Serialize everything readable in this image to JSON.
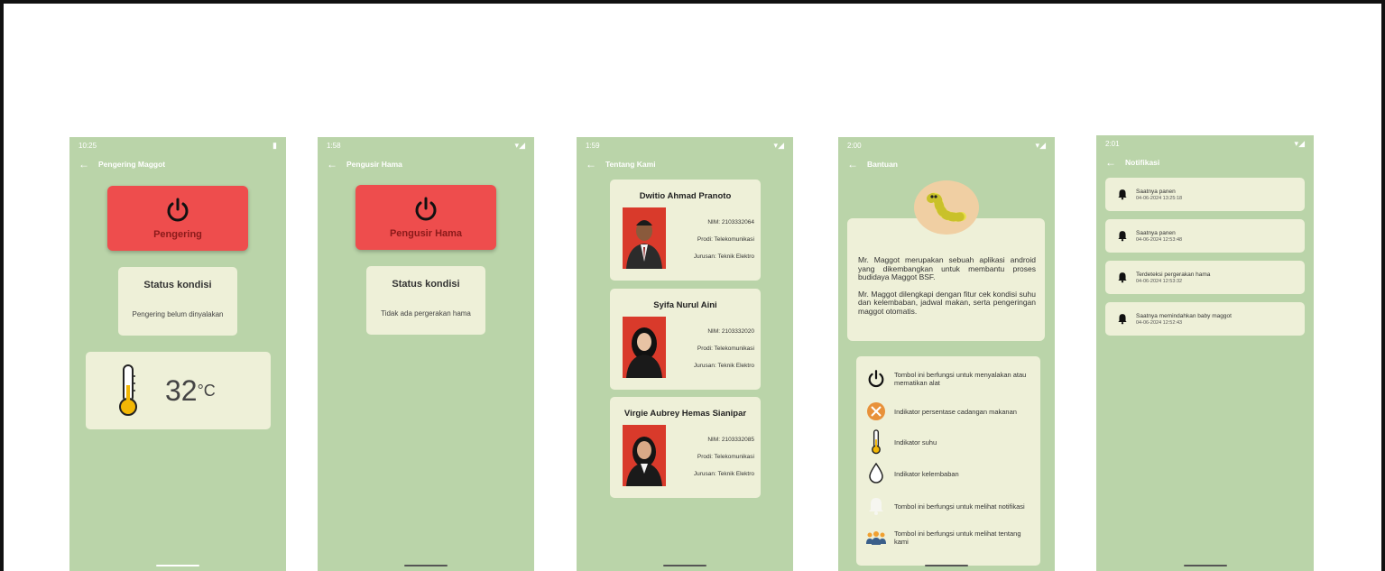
{
  "screens": [
    {
      "status_time": "10:25",
      "title": "Pengering Maggot",
      "power_label": "Pengering",
      "status_title": "Status kondisi",
      "status_text": "Pengering belum dinyalakan",
      "temperature_value": "32",
      "temperature_unit": "°C"
    },
    {
      "status_time": "1:58",
      "title": "Pengusir Hama",
      "power_label": "Pengusir Hama",
      "status_title": "Status kondisi",
      "status_text": "Tidak ada pergerakan hama"
    },
    {
      "status_time": "1:59",
      "title": "Tentang Kami",
      "members": [
        {
          "name": "Dwitio Ahmad Pranoto",
          "nim": "NIM: 2103332064",
          "prodi": "Prodi: Telekomunikasi",
          "jurusan": "Jurusan: Teknik Elektro"
        },
        {
          "name": "Syifa Nurul Aini",
          "nim": "NIM: 2103332020",
          "prodi": "Prodi: Telekomunikasi",
          "jurusan": "Jurusan: Teknik Elektro"
        },
        {
          "name": "Virgie Aubrey Hemas Sianipar",
          "nim": "NIM: 2103332085",
          "prodi": "Prodi: Telekomunikasi",
          "jurusan": "Jurusan: Teknik Elektro"
        }
      ]
    },
    {
      "status_time": "2:00",
      "title": "Bantuan",
      "about_p1": "Mr. Maggot merupakan sebuah aplikasi android yang dikembangkan untuk membantu proses budidaya Maggot BSF.",
      "about_p2": "Mr. Maggot dilengkapi dengan fitur cek kondisi suhu dan kelembaban, jadwal makan, serta pengeringan maggot otomatis.",
      "legend": [
        {
          "icon": "power-icon",
          "text": "Tombol ini berfungsi untuk menyalakan atau mematikan alat"
        },
        {
          "icon": "food-icon",
          "text": "Indikator persentase cadangan makanan"
        },
        {
          "icon": "thermometer-icon",
          "text": "Indikator suhu"
        },
        {
          "icon": "droplet-icon",
          "text": "Indikator kelembaban"
        },
        {
          "icon": "bell-icon",
          "text": "Tombol ini berfungsi untuk melihat notifikasi"
        },
        {
          "icon": "team-icon",
          "text": "Tombol ini berfungsi untuk melihat tentang kami"
        }
      ]
    },
    {
      "status_time": "2:01",
      "title": "Notifikasi",
      "notifications": [
        {
          "title": "Saatnya panen",
          "time": "04-06-2024 13:25:18"
        },
        {
          "title": "Saatnya panen",
          "time": "04-06-2024 12:53:48"
        },
        {
          "title": "Terdeteksi pergerakan hama",
          "time": "04-06-2024 12:53:32"
        },
        {
          "title": "Saatnya memindahkan baby maggot",
          "time": "04-06-2024 12:52:43"
        }
      ]
    }
  ],
  "colors": {
    "screen_bg": "#bad4a9",
    "card_bg": "#eef0d8",
    "power_red": "#ee4d4d",
    "power_label": "#8b1a1a"
  }
}
